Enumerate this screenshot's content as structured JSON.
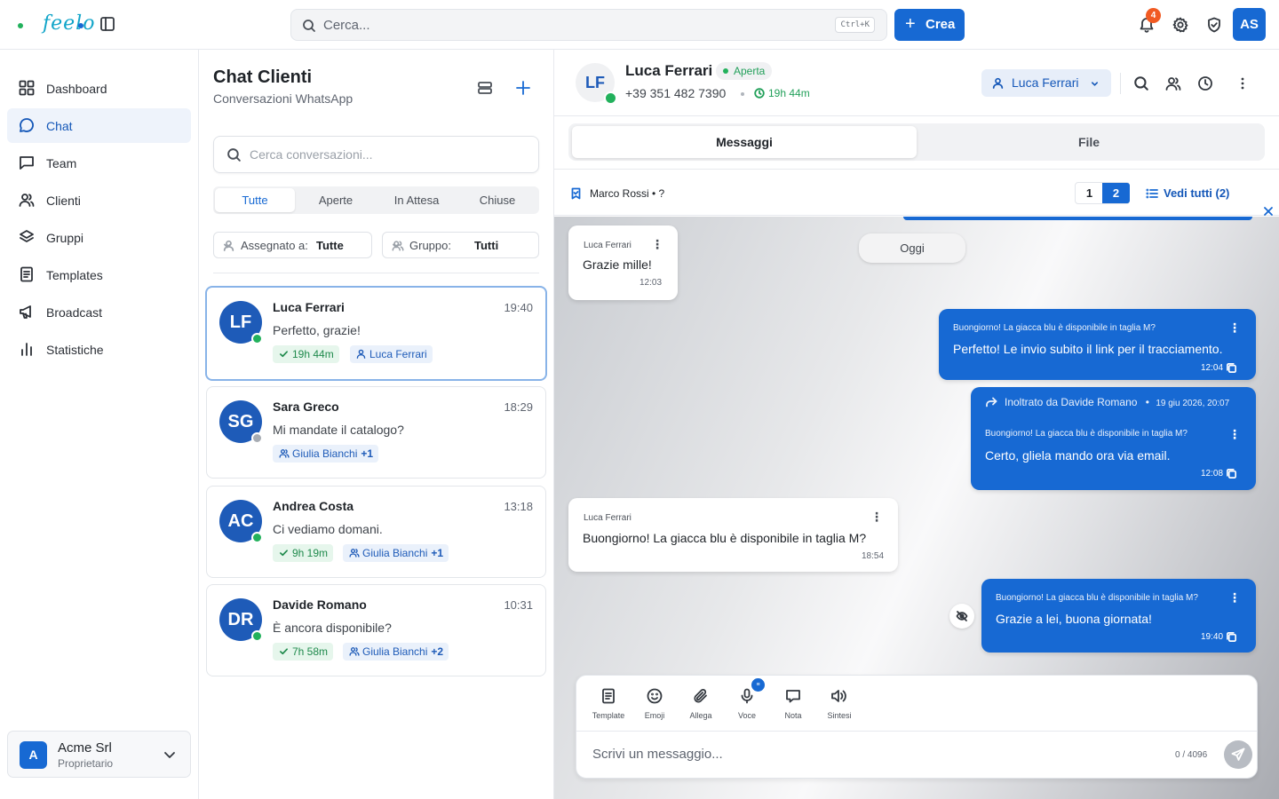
{
  "app": {
    "logo_text": "feelo",
    "brand_color": "#1769d3",
    "accent_color": "#12a5c9"
  },
  "topbar": {
    "search_placeholder": "Cerca...",
    "search_shortcut": "Ctrl+K",
    "create_label": "Crea",
    "notifications_count": "4",
    "user_initials": "AS"
  },
  "sidebar": {
    "items": [
      {
        "label": "Dashboard",
        "icon": "grid-icon"
      },
      {
        "label": "Chat",
        "icon": "chat-icon",
        "active": true
      },
      {
        "label": "Team",
        "icon": "message-square-icon"
      },
      {
        "label": "Clienti",
        "icon": "users-icon"
      },
      {
        "label": "Gruppi",
        "icon": "layers-icon"
      },
      {
        "label": "Templates",
        "icon": "file-text-icon"
      },
      {
        "label": "Broadcast",
        "icon": "megaphone-icon"
      },
      {
        "label": "Statistiche",
        "icon": "bar-chart-icon"
      }
    ],
    "org": {
      "initial": "A",
      "name": "Acme Srl",
      "role": "Proprietario"
    }
  },
  "conversations": {
    "title": "Chat Clienti",
    "subtitle": "Conversazioni WhatsApp",
    "search_placeholder": "Cerca conversazioni...",
    "tabs": [
      "Tutte",
      "Aperte",
      "In Attesa",
      "Chiuse"
    ],
    "active_tab": "Tutte",
    "filters": {
      "assigned_label": "Assegnato a:",
      "assigned_value": "Tutte",
      "group_label": "Gruppo:",
      "group_value": "Tutti"
    },
    "items": [
      {
        "initials": "LF",
        "name": "Luca Ferrari",
        "time": "19:40",
        "message": "Perfetto, grazie!",
        "online": true,
        "timer": "19h 44m",
        "assignee": "Luca Ferrari",
        "extra": ""
      },
      {
        "initials": "SG",
        "name": "Sara Greco",
        "time": "18:29",
        "message": "Mi mandate il catalogo?",
        "online": false,
        "timer": "",
        "assignee": "Giulia Bianchi",
        "extra": "+1"
      },
      {
        "initials": "AC",
        "name": "Andrea Costa",
        "time": "13:18",
        "message": "Ci vediamo domani.",
        "online": true,
        "timer": "9h 19m",
        "assignee": "Giulia Bianchi",
        "extra": "+1"
      },
      {
        "initials": "DR",
        "name": "Davide Romano",
        "time": "10:31",
        "message": "È ancora disponibile?",
        "online": true,
        "timer": "7h 58m",
        "assignee": "Giulia Bianchi",
        "extra": "+2"
      }
    ]
  },
  "chat": {
    "contact": {
      "initials": "LF",
      "name": "Luca Ferrari",
      "status": "Aperta",
      "phone": "+39 351 482 7390",
      "timer": "19h 44m"
    },
    "assignee": "Luca Ferrari",
    "tabs": [
      "Messaggi",
      "File"
    ],
    "pinned": {
      "text": "Marco Rossi • ?",
      "pages": [
        "1",
        "2"
      ],
      "active_page": "2",
      "view_all": "Vedi tutti (2)"
    },
    "date_separator": "Oggi",
    "messages": [
      {
        "direction": "in",
        "sender": "Luca Ferrari",
        "text": "Grazie mille!",
        "time": "12:03"
      },
      {
        "direction": "out",
        "quote": "Buongiorno! La giacca blu è disponibile in taglia M?",
        "text": "Perfetto! Le invio subito il link per il tracciamento.",
        "time": "12:04"
      },
      {
        "direction": "out",
        "forwarded": "Inoltrato da Davide Romano",
        "forwarded_date": "19 giu 2026, 20:07",
        "quote": "Buongiorno! La giacca blu è disponibile in taglia M?",
        "text": "Certo, gliela mando ora via email.",
        "time": "12:08"
      },
      {
        "direction": "in",
        "sender": "Luca Ferrari",
        "text": "Buongiorno! La giacca blu è disponibile in taglia M?",
        "time": "18:54"
      },
      {
        "direction": "out",
        "quote": "Buongiorno! La giacca blu è disponibile in taglia M?",
        "text": "Grazie a lei, buona giornata!",
        "time": "19:40"
      }
    ],
    "composer": {
      "tools": [
        "Template",
        "Emoji",
        "Allega",
        "Voce",
        "Nota",
        "Sintesi"
      ],
      "placeholder": "Scrivi un messaggio...",
      "counter": "0 / 4096"
    }
  }
}
